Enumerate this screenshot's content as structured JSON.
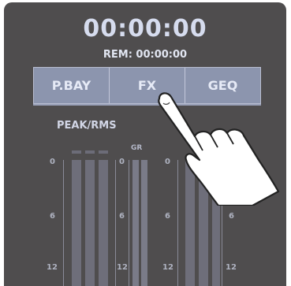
{
  "display": {
    "timer": "00:00:00",
    "remaining": "REM: 00:00:00"
  },
  "tabs": [
    {
      "label": "P.BAY"
    },
    {
      "label": "FX"
    },
    {
      "label": "GEQ"
    }
  ],
  "meters": {
    "title": "PEAK/RMS",
    "gr_label": "GR",
    "scale": [
      "0",
      "6",
      "12"
    ]
  },
  "colors": {
    "panel": "#4f4d4e",
    "tab_bar": "#8c95ae",
    "text": "#d6dcee"
  }
}
